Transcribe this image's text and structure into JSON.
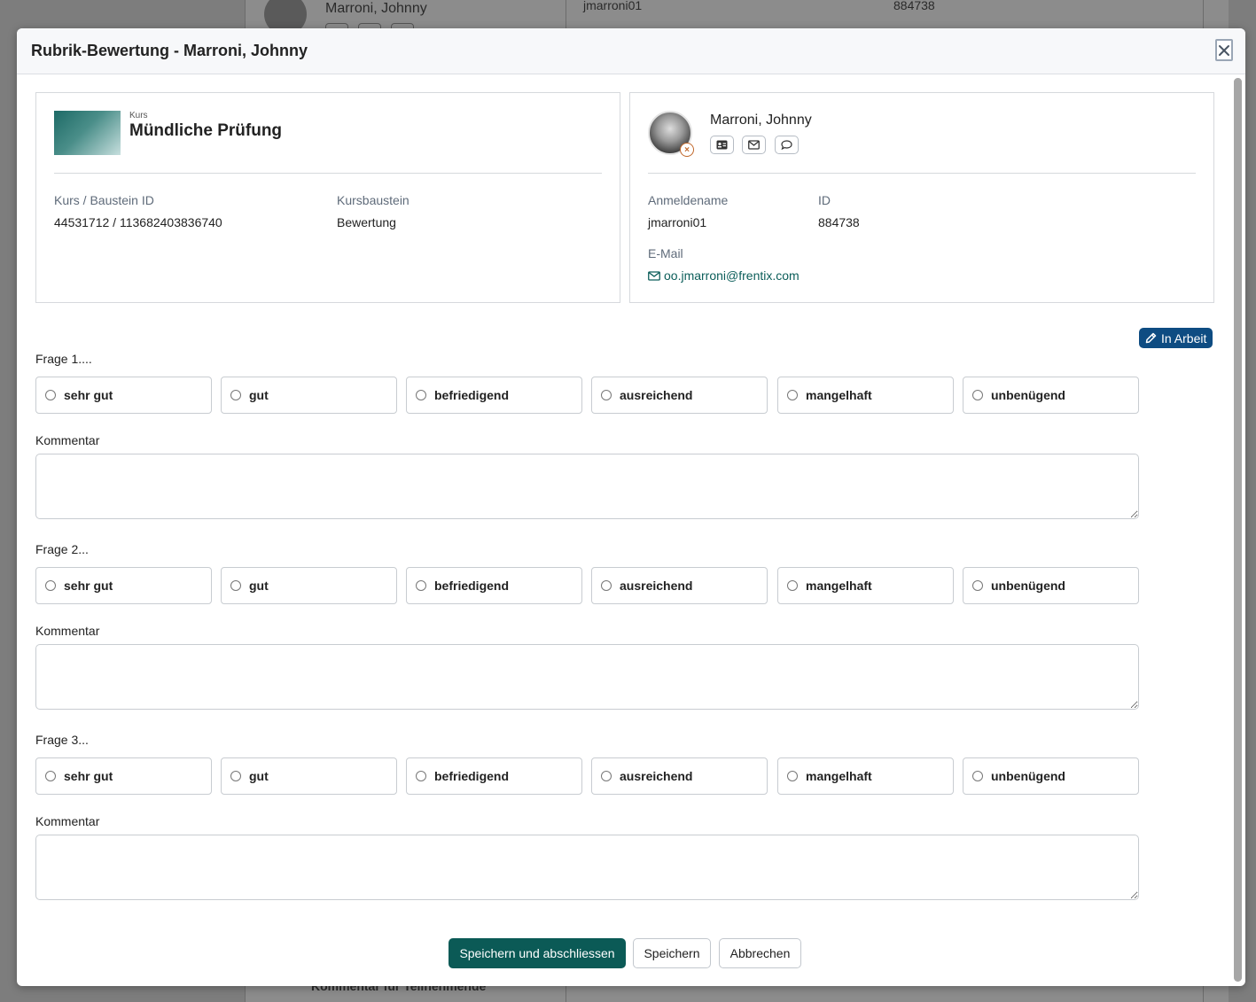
{
  "background": {
    "name": "Marroni, Johnny",
    "username": "jmarroni01",
    "id": "884738",
    "footer_text": "Kommentar für Teilnehmende"
  },
  "modal": {
    "title": "Rubrik-Bewertung - Marroni, Johnny",
    "close_icon": "close-icon"
  },
  "course": {
    "kicker": "Kurs",
    "title": "Mündliche Prüfung",
    "id_label": "Kurs / Baustein ID",
    "id_value": "44531712 / 113682403836740",
    "element_label": "Kursbaustein",
    "element_value": "Bewertung"
  },
  "user": {
    "name": "Marroni, Johnny",
    "icons": [
      "id-card-icon",
      "envelope-icon",
      "chat-icon"
    ],
    "login_label": "Anmeldename",
    "login_value": "jmarroni01",
    "id_label": "ID",
    "id_value": "884738",
    "email_label": "E-Mail",
    "email_value": "oo.jmarroni@frentix.com"
  },
  "status": {
    "label": "In Arbeit",
    "color": "#0e4c82"
  },
  "questions": [
    {
      "label": "Frage 1....",
      "options": [
        "sehr gut",
        "gut",
        "befriedigend",
        "ausreichend",
        "mangelhaft",
        "unbenügend"
      ],
      "comment_label": "Kommentar",
      "comment_value": ""
    },
    {
      "label": "Frage 2...",
      "options": [
        "sehr gut",
        "gut",
        "befriedigend",
        "ausreichend",
        "mangelhaft",
        "unbenügend"
      ],
      "comment_label": "Kommentar",
      "comment_value": ""
    },
    {
      "label": "Frage 3...",
      "options": [
        "sehr gut",
        "gut",
        "befriedigend",
        "ausreichend",
        "mangelhaft",
        "unbenügend"
      ],
      "comment_label": "Kommentar",
      "comment_value": ""
    }
  ],
  "actions": {
    "save_close": "Speichern und abschliessen",
    "save": "Speichern",
    "cancel": "Abbrechen"
  },
  "colors": {
    "primary": "#0b5a56",
    "link": "#0c5e5a"
  }
}
